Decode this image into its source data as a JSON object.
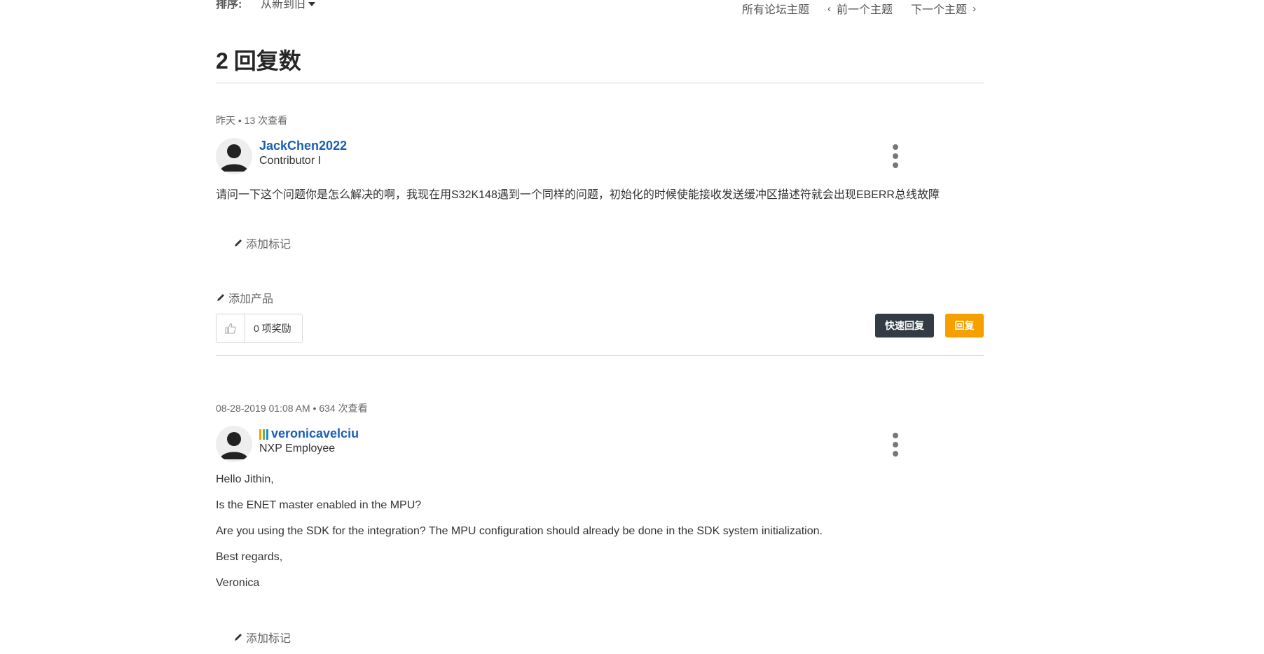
{
  "sort": {
    "label": "排序:",
    "value": "从新到旧"
  },
  "topic_nav": {
    "all_topics": "所有论坛主题",
    "prev": "前一个主题",
    "next": "下一个主题"
  },
  "replies": {
    "count": "2",
    "label": "回复数"
  },
  "posts": [
    {
      "date": "昨天",
      "views": "13 次查看",
      "author": "JackChen2022",
      "rank": "Contributor I",
      "body": [
        "请问一下这个问题你是怎么解决的啊，我现在用S32K148遇到一个同样的问题，初始化的时候使能接收发送缓冲区描述符就会出现EBERR总线故障"
      ],
      "add_tag": "添加标记",
      "add_product": "添加产品",
      "kudos": "0 项奖励",
      "quick_reply": "快速回复",
      "reply": "回复"
    },
    {
      "date": "08-28-2019 01:08 AM",
      "views": "634 次查看",
      "author": "veronicavelciu",
      "rank": "NXP Employee",
      "rank_bar_colors": [
        "#f5a000",
        "#6db33f",
        "#1a8fd0"
      ],
      "body": [
        "Hello Jithin,",
        "Is the ENET master enabled in the MPU?",
        "Are you using the SDK for the integration? The MPU configuration should already be done in the SDK system initialization.",
        "Best regards,",
        "Veronica"
      ],
      "add_tag": "添加标记"
    }
  ],
  "separator": " • ",
  "icons": {
    "avatar": "user-avatar-icon",
    "menu": "kebab-menu-icon",
    "pencil": "pencil-icon",
    "thumb": "thumbs-up-icon",
    "chevron_left": "chevron-left-icon",
    "chevron_right": "chevron-right-icon",
    "caret": "caret-down-icon"
  }
}
